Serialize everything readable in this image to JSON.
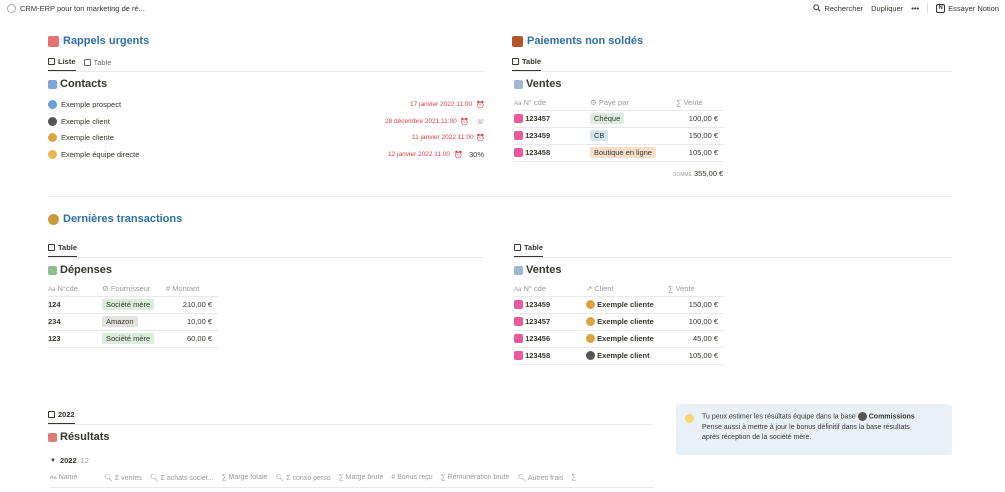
{
  "topbar": {
    "breadcrumb": "CRM-ERP pour ton marketing de ré...",
    "search": "Rechercher",
    "duplicate": "Dupliquer",
    "more": "•••",
    "try_notion": "Essayer Notion"
  },
  "rappels": {
    "title": "Rappels urgents",
    "tabs": [
      "Liste",
      "Table"
    ],
    "subtitle": "Contacts",
    "items": [
      {
        "name": "Exemple prospect",
        "date": "17 janvier 2022 11:00",
        "extra": ""
      },
      {
        "name": "Exemple client",
        "date": "28 décembre 2021 11:00",
        "extra": ""
      },
      {
        "name": "Exemple cliente",
        "date": "11 janvier 2022 11:00",
        "extra": ""
      },
      {
        "name": "Exemple équipe directe",
        "date": "12 janvier 2022 11:00",
        "extra": "30%"
      }
    ]
  },
  "paiements": {
    "title": "Paiements non soldés",
    "tab": "Table",
    "subtitle": "Ventes",
    "headers": [
      "N° cde",
      "Payé par",
      "Vente"
    ],
    "rows": [
      {
        "id": "123457",
        "paid": "Chèque",
        "color": "#dbeddb",
        "amount": "100,00 €"
      },
      {
        "id": "123459",
        "paid": "CB",
        "color": "#d3e5ef",
        "amount": "150,00 €"
      },
      {
        "id": "123458",
        "paid": "Boutique en ligne",
        "color": "#fadec9",
        "amount": "105,00 €"
      }
    ],
    "sum_label": "SOMME",
    "sum": "355,00 €"
  },
  "transactions": {
    "title": "Dernières transactions",
    "depenses": {
      "tab": "Table",
      "subtitle": "Dépenses",
      "headers": [
        "N°cde",
        "Fournisseur",
        "Montant"
      ],
      "rows": [
        {
          "id": "124",
          "supplier": "Société mère",
          "color": "#dbeddb",
          "amount": "210,00 €"
        },
        {
          "id": "234",
          "supplier": "Amazon",
          "color": "#e3e2e0",
          "amount": "10,00 €"
        },
        {
          "id": "123",
          "supplier": "Société mère",
          "color": "#dbeddb",
          "amount": "60,00 €"
        }
      ]
    },
    "ventes": {
      "tab": "Table",
      "subtitle": "Ventes",
      "headers": [
        "N° cde",
        "Client",
        "Vente"
      ],
      "rows": [
        {
          "id": "123459",
          "client": "Exemple cliente",
          "amount": "150,00 €"
        },
        {
          "id": "123457",
          "client": "Exemple cliente",
          "amount": "100,00 €"
        },
        {
          "id": "123456",
          "client": "Exemple cliente",
          "amount": "45,00 €"
        },
        {
          "id": "123458",
          "client": "Exemple client",
          "amount": "105,00 €"
        }
      ]
    }
  },
  "resultats": {
    "tab": "2022",
    "subtitle": "Résultats",
    "group": "2022",
    "group_count": "12",
    "headers": [
      "Name",
      "Σ ventes",
      "Σ achats sociét...",
      "Marge totale",
      "Σ conso perso",
      "Marge brute",
      "Bonus reçu",
      "Rémunération brute",
      "Autres frais",
      ""
    ]
  },
  "callout": {
    "line1": "Tu peux estimer les résultats équipe dans la base",
    "bold": "Commissions",
    "line2": "Pense aussi à mettre à jour le bonus définitif dans la base résultats",
    "line3": "après réception de la société mère."
  }
}
